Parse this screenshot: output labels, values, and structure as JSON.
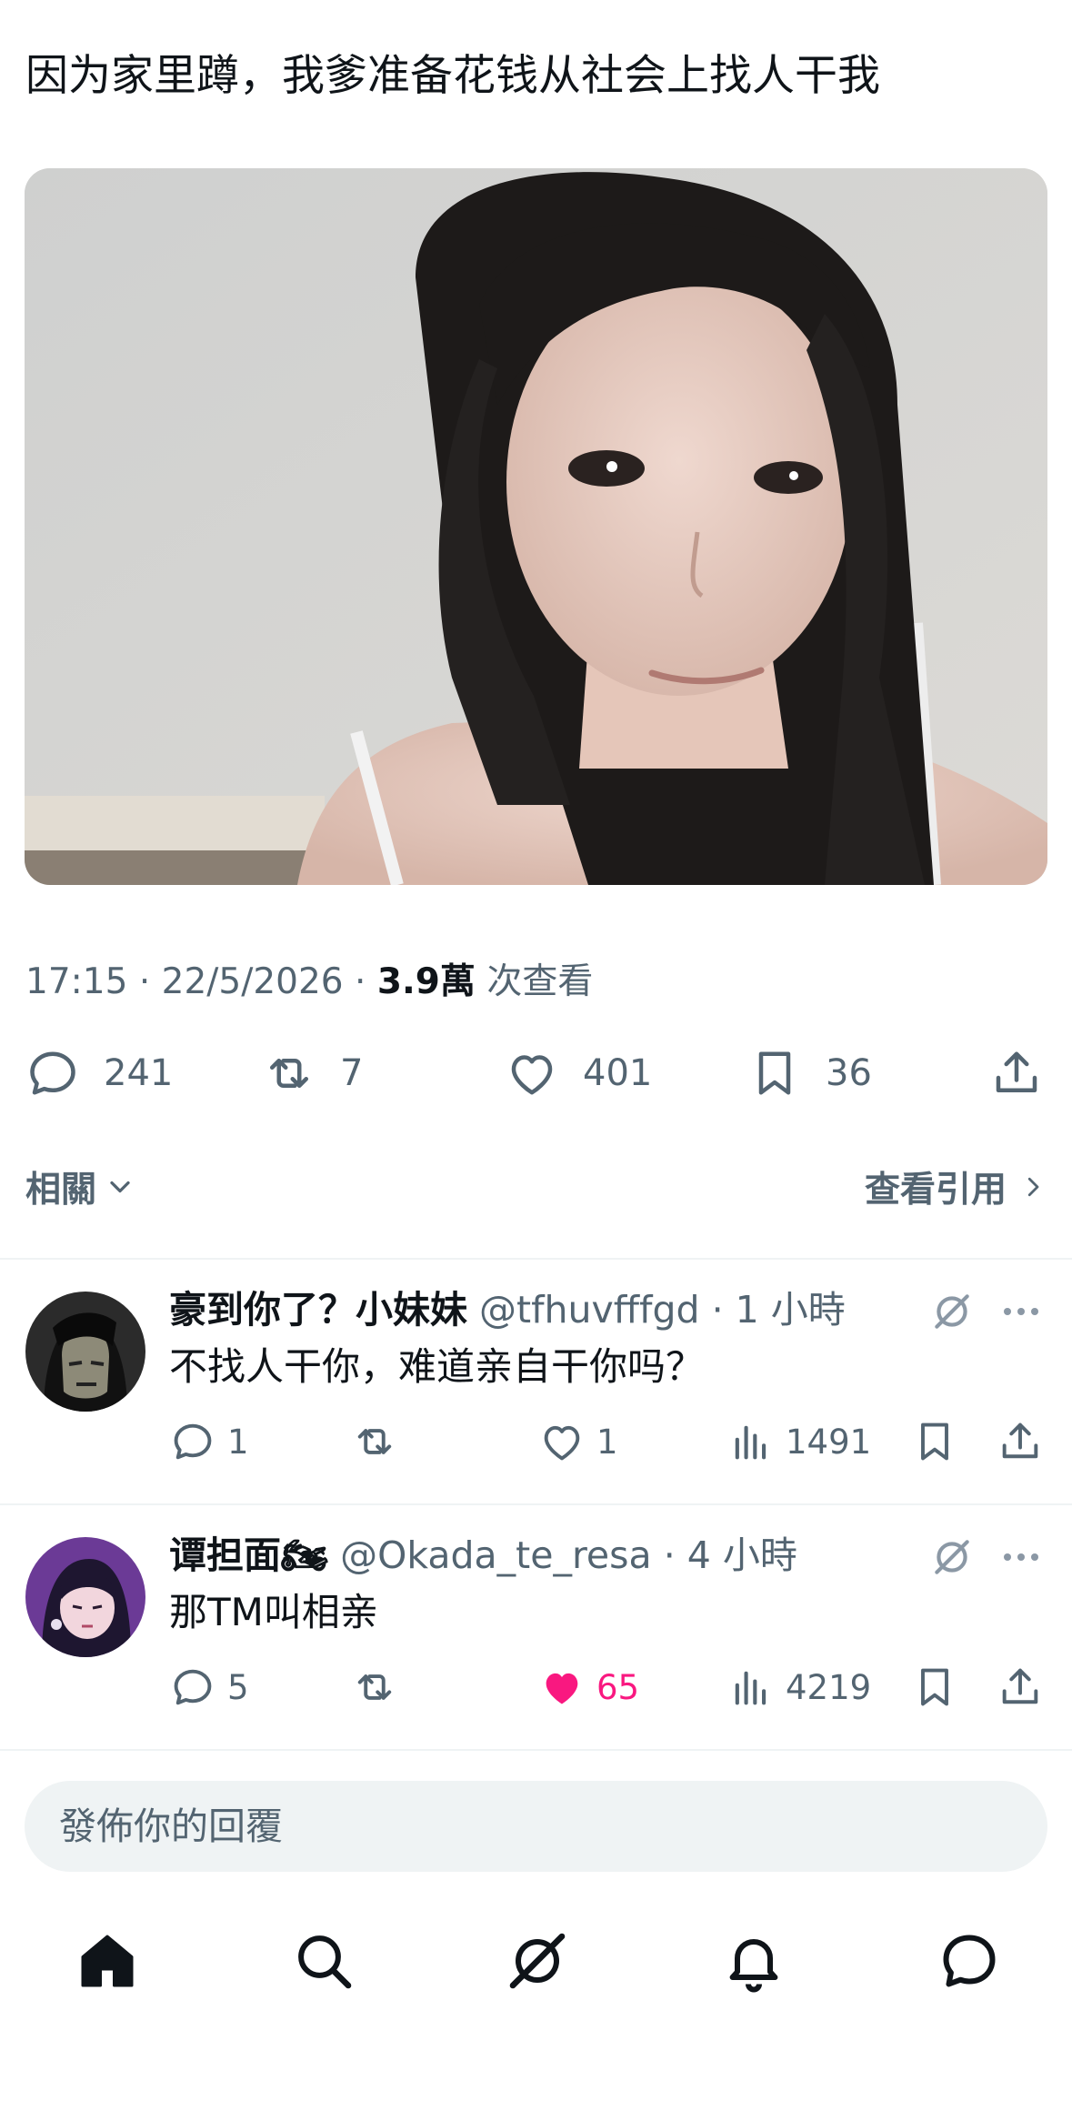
{
  "tweet": {
    "text": "因为家里蹲，我爹准备花钱从社会上找人干我",
    "photo_alt": "selfie photo",
    "time": "17:15",
    "date": "22/5/2026",
    "views_count": "3.9萬",
    "views_label": "次查看",
    "sep": "·"
  },
  "actions": {
    "replies": "241",
    "retweets": "7",
    "likes": "401",
    "bookmarks": "36"
  },
  "related": {
    "label": "相關",
    "view_quotes": "查看引用"
  },
  "replies": [
    {
      "name": "豪到你了？小妹妹",
      "handle": "@tfhuvfffgd",
      "time": "1 小時",
      "text": "不找人干你，难道亲自干你吗？",
      "replies": "1",
      "retweets": "",
      "likes": "1",
      "views": "1491",
      "liked": false
    },
    {
      "name": "谭担面🏍",
      "handle": "@Okada_te_resa",
      "time": "4 小時",
      "text": "那TM叫相亲",
      "replies": "5",
      "retweets": "",
      "likes": "65",
      "views": "4219",
      "liked": true
    }
  ],
  "reply_bar": {
    "placeholder": "發佈你的回覆"
  },
  "colors": {
    "text": "#0f1419",
    "secondary": "#536471",
    "like": "#f91880",
    "input_bg": "#eff3f4"
  },
  "nav": {
    "items": [
      "home-icon",
      "search-icon",
      "grok-icon",
      "bell-icon",
      "messages-icon"
    ]
  }
}
